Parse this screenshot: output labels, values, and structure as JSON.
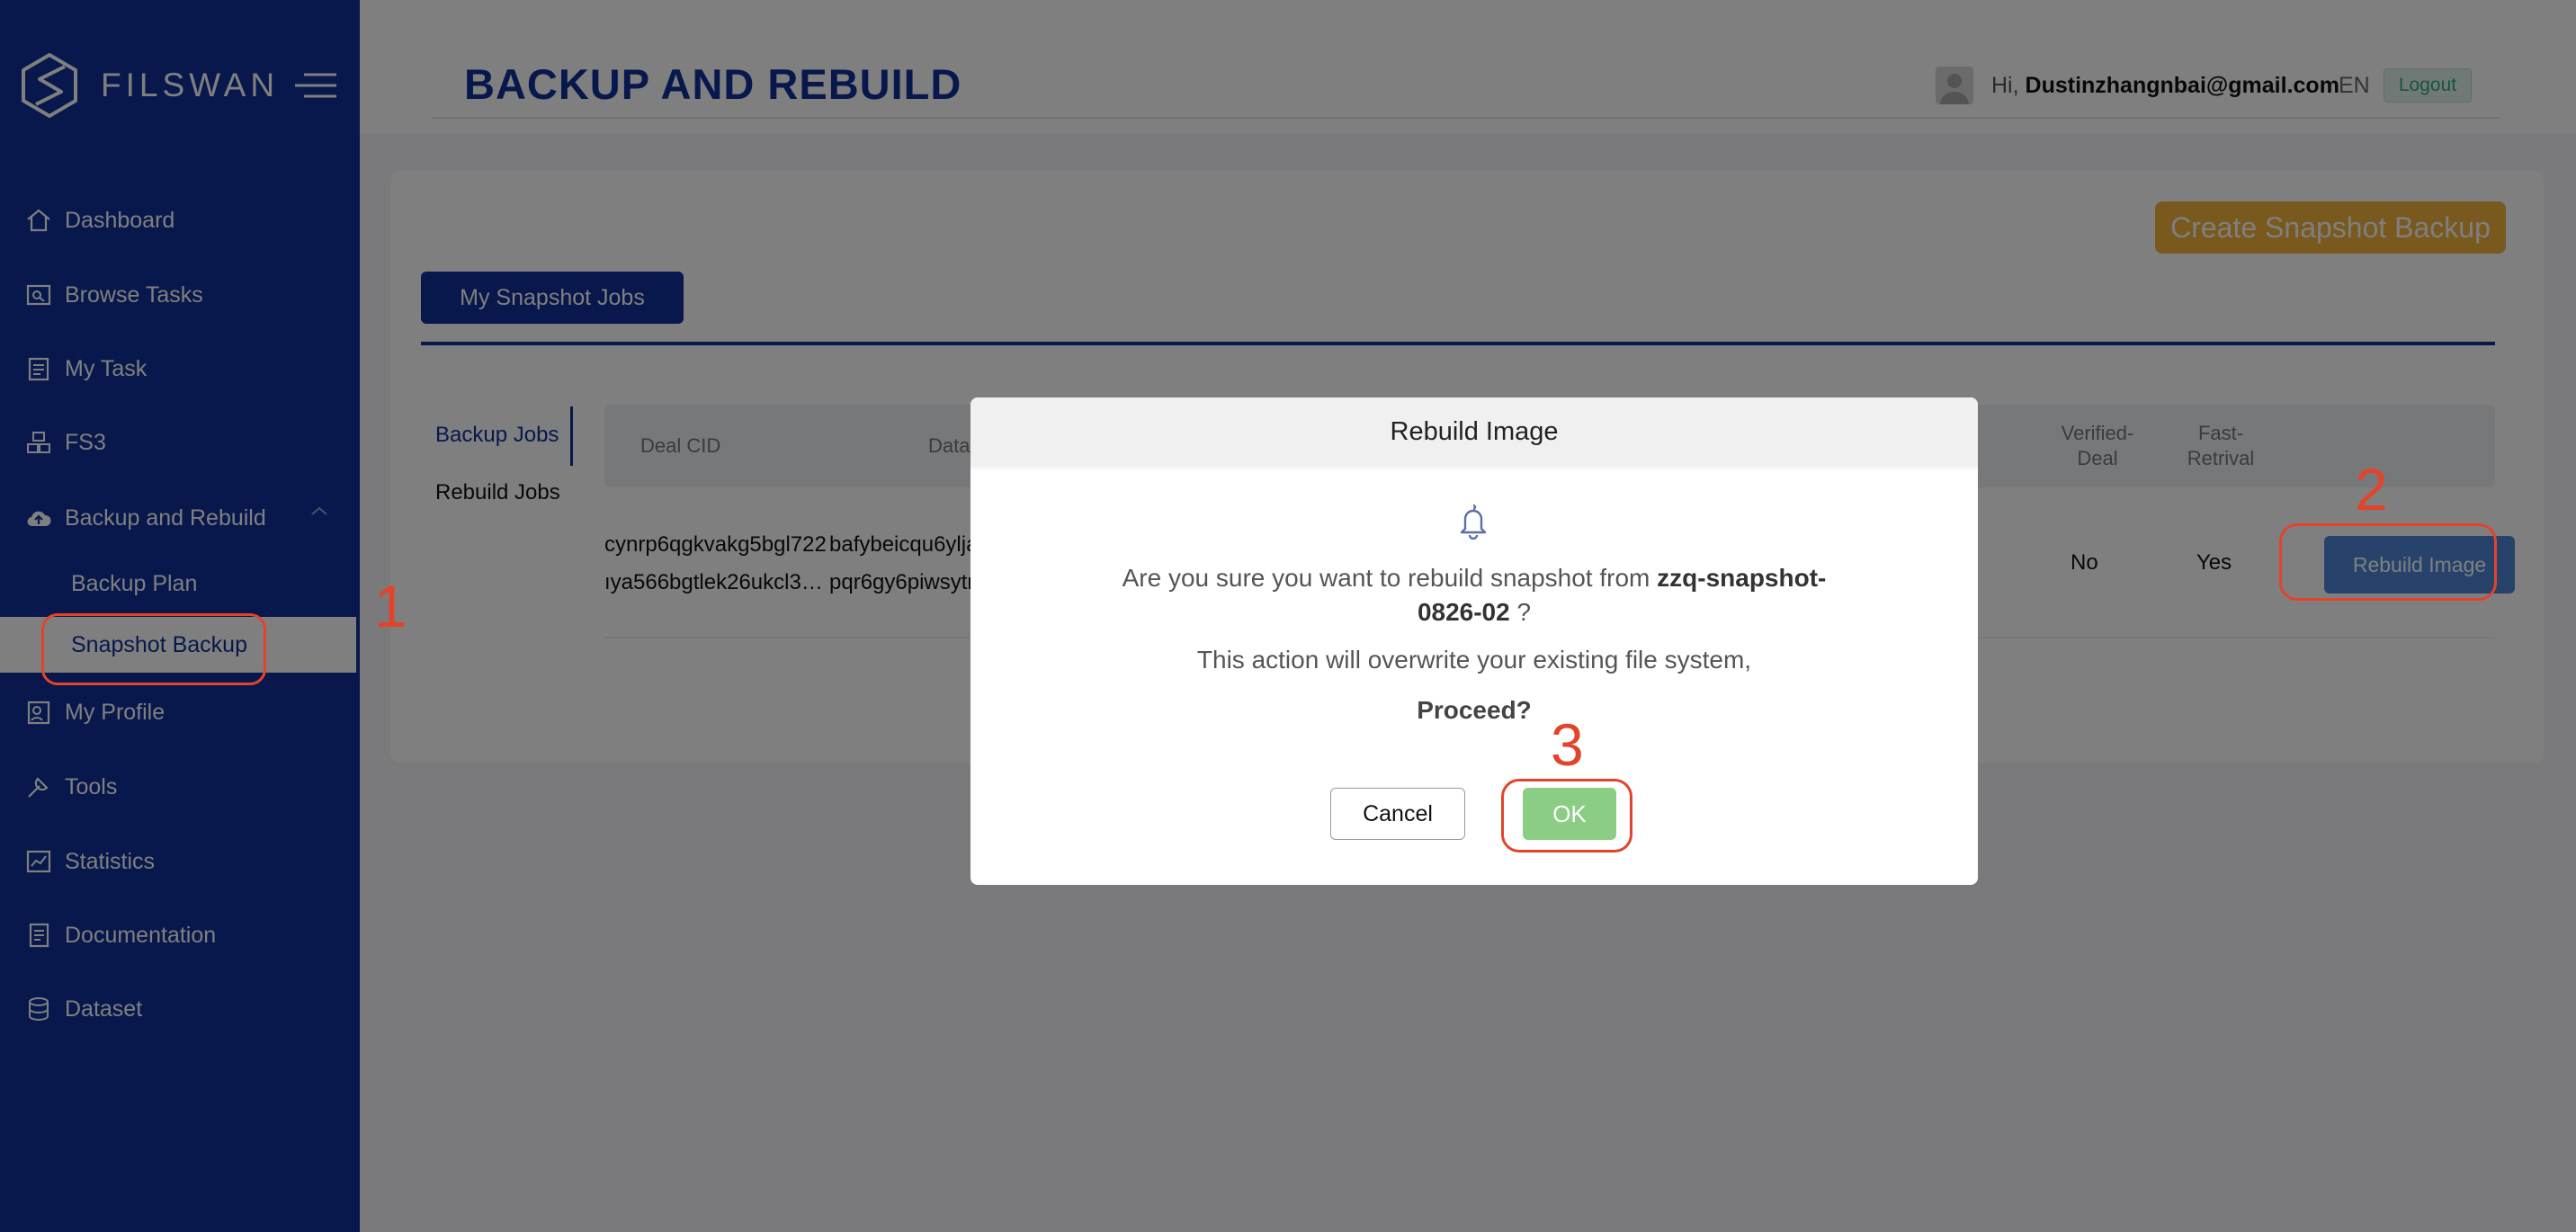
{
  "brand": {
    "name": "FILSWAN"
  },
  "sidebar": {
    "items": [
      {
        "label": "Dashboard",
        "icon": "home-icon"
      },
      {
        "label": "Browse Tasks",
        "icon": "browse-icon"
      },
      {
        "label": "My Task",
        "icon": "task-icon"
      },
      {
        "label": "FS3",
        "icon": "fs3-icon"
      },
      {
        "label": "Backup and Rebuild",
        "icon": "cloud-upload-icon"
      },
      {
        "label": "My Profile",
        "icon": "profile-icon"
      },
      {
        "label": "Tools",
        "icon": "tools-icon"
      },
      {
        "label": "Statistics",
        "icon": "statistics-icon"
      },
      {
        "label": "Documentation",
        "icon": "documentation-icon"
      },
      {
        "label": "Dataset",
        "icon": "dataset-icon"
      }
    ],
    "subitems": [
      {
        "label": "Backup Plan"
      },
      {
        "label": "Snapshot Backup"
      }
    ]
  },
  "header": {
    "title": "BACKUP AND REBUILD",
    "greeting": "Hi,",
    "email": "Dustinzhangnbai@gmail.com",
    "language": "EN",
    "logout": "Logout"
  },
  "content": {
    "create_button": "Create Snapshot Backup",
    "tab": "My Snapshot Jobs",
    "subtabs": {
      "backup": "Backup Jobs",
      "rebuild": "Rebuild Jobs"
    },
    "columns": {
      "deal_cid": "Deal CID",
      "data": "Data",
      "verified": "Verified-\nDeal",
      "fast": "Fast-\nRetrival"
    },
    "row": {
      "cid_line1": "cynrp6qgkvakg5bgl722",
      "cid_line2": "ıya566bgtlek26ukcl3…",
      "data_line1": "bafybeicqu6ylja",
      "data_line2": "pqr6gy6piwsytr",
      "verified": "No",
      "fast": "Yes",
      "action": "Rebuild Image"
    }
  },
  "modal": {
    "title": "Rebuild Image",
    "message_prefix": "Are you sure you want to rebuild snapshot from",
    "snapshot_name": "zzq-snapshot-0826-02",
    "message_suffix": "?",
    "warning": "This action will overwrite your existing file system,",
    "proceed": "Proceed?",
    "cancel": "Cancel",
    "ok": "OK"
  },
  "annotations": {
    "one": "1",
    "two": "2",
    "three": "3"
  },
  "colors": {
    "sidebar": "#103198",
    "accent": "#103198",
    "create_button": "#f2b33c",
    "ok_button": "#8ccd86",
    "rebuild_button": "#4f86d6",
    "annotation": "#e2442b"
  }
}
